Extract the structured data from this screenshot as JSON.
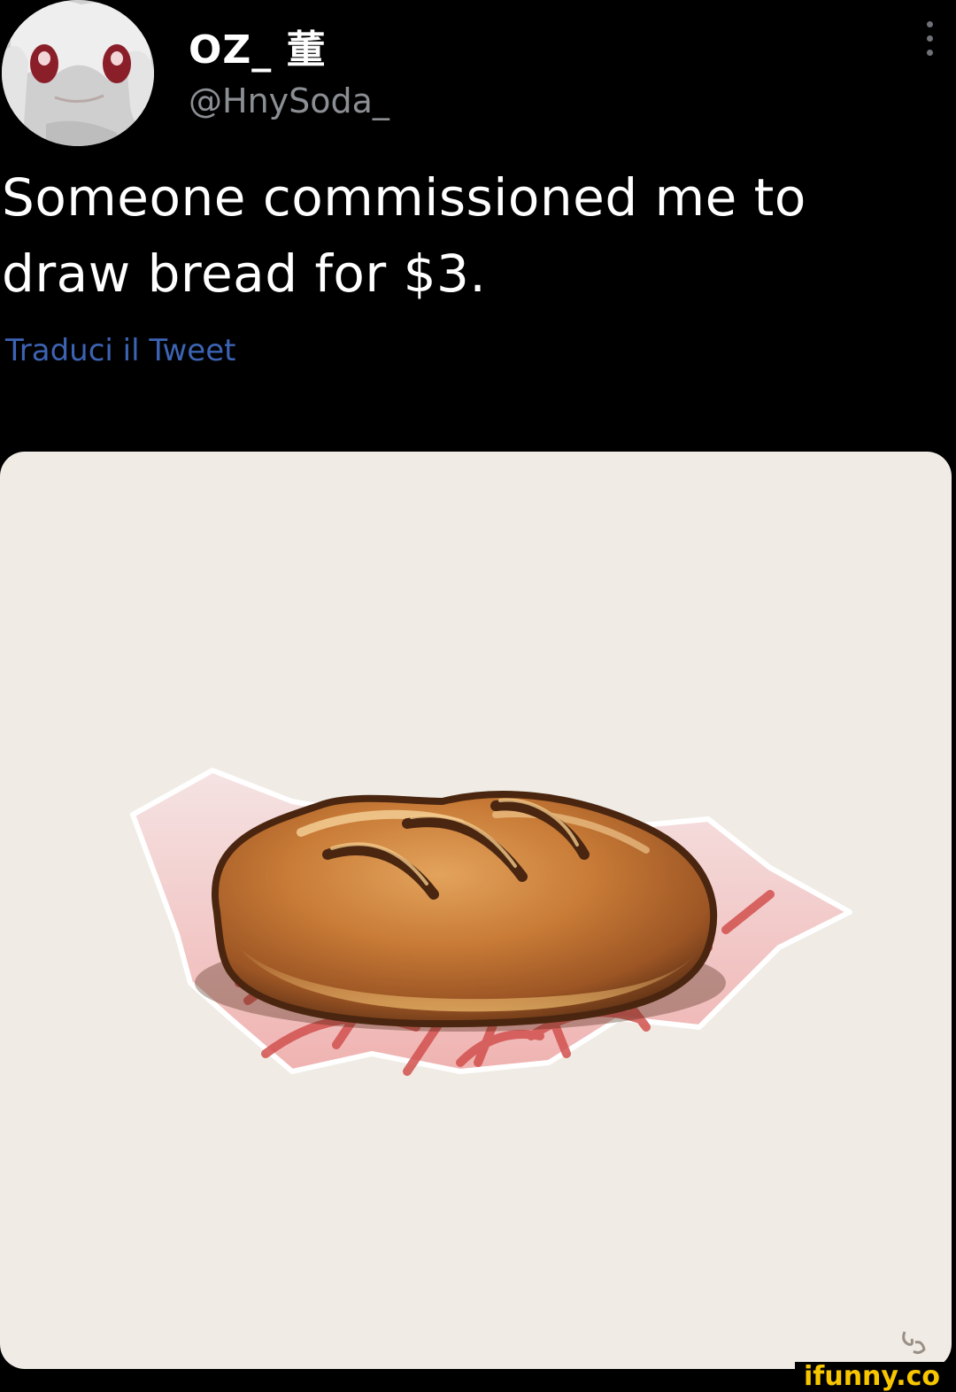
{
  "tweet": {
    "display_name": "OZ_ 董",
    "handle": "@HnySoda_",
    "text": "Someone commissioned me to draw bread for $3.",
    "translate_label": "Traduci il Tweet"
  },
  "icons": {
    "more": "more-vertical-icon",
    "avatar": "avatar-image"
  },
  "watermark": {
    "text": "ifunny.co"
  },
  "colors": {
    "background": "#000000",
    "text": "#ffffff",
    "handle": "#8b8f94",
    "link": "#3c63b4",
    "card": "#f0ece5",
    "watermark": "#f7c600"
  }
}
